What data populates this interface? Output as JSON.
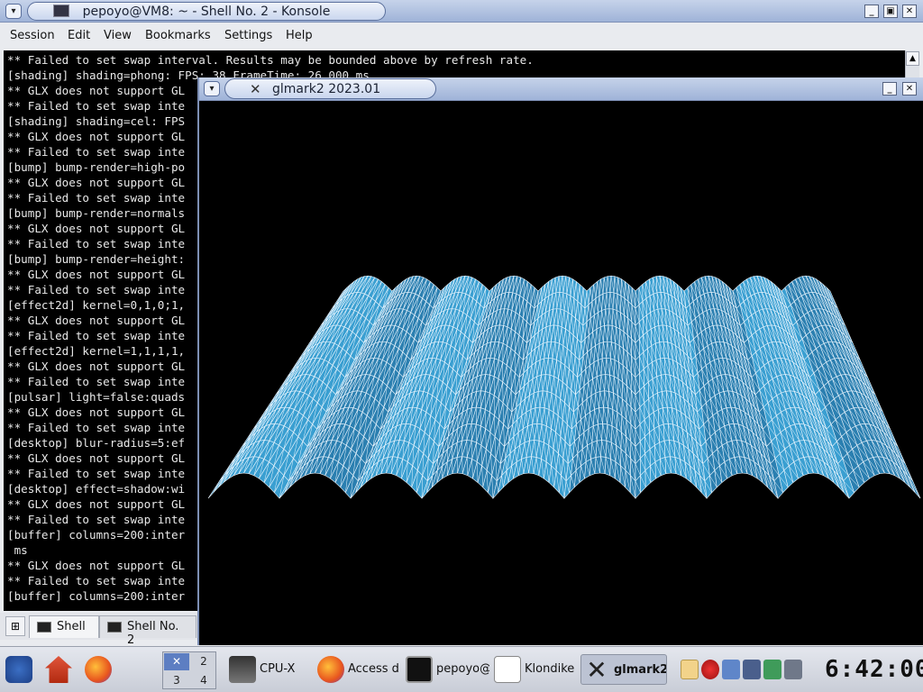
{
  "konsole": {
    "title": "pepoyo@VM8: ~ - Shell No. 2 - Konsole",
    "menu": [
      "Session",
      "Edit",
      "View",
      "Bookmarks",
      "Settings",
      "Help"
    ],
    "lines": [
      "** Failed to set swap interval. Results may be bounded above by refresh rate.",
      "[shading] shading=phong: FPS: 38 FrameTime: 26.000 ms",
      "** GLX does not support GL",
      "** Failed to set swap inte",
      "[shading] shading=cel: FPS",
      "** GLX does not support GL",
      "** Failed to set swap inte",
      "[bump] bump-render=high-po",
      "** GLX does not support GL",
      "** Failed to set swap inte",
      "[bump] bump-render=normals",
      "** GLX does not support GL",
      "** Failed to set swap inte",
      "[bump] bump-render=height:",
      "** GLX does not support GL",
      "** Failed to set swap inte",
      "[effect2d] kernel=0,1,0;1,",
      "** GLX does not support GL",
      "** Failed to set swap inte",
      "[effect2d] kernel=1,1,1,1,",
      "** GLX does not support GL",
      "** Failed to set swap inte",
      "[pulsar] light=false:quads",
      "** GLX does not support GL",
      "** Failed to set swap inte",
      "[desktop] blur-radius=5:ef",
      "** GLX does not support GL",
      "** Failed to set swap inte",
      "[desktop] effect=shadow:wi",
      "** GLX does not support GL",
      "** Failed to set swap inte",
      "[buffer] columns=200:inter",
      " ms",
      "** GLX does not support GL",
      "** Failed to set swap inte",
      "[buffer] columns=200:inter"
    ],
    "tabs": [
      "Shell",
      "Shell No. 2"
    ]
  },
  "glmark": {
    "title": "glmark2 2023.01"
  },
  "panel": {
    "pager": [
      "1",
      "2",
      "3",
      "4"
    ],
    "tasks": [
      "CPU-X",
      "Access d",
      "pepoyo@",
      "Klondike",
      "glmark2"
    ],
    "clock": "6:42:00"
  },
  "colors": {
    "mesh": "#3a9fd1",
    "mesh_line": "#eaf6ff",
    "terminal_bg": "#000000",
    "titlebar": "#b3c4e3"
  },
  "icons": {
    "new_tab": "new-tab-icon",
    "terminal": "terminal-icon",
    "kde": "kde-menu-icon",
    "home": "home-icon",
    "firefox": "firefox-icon"
  }
}
